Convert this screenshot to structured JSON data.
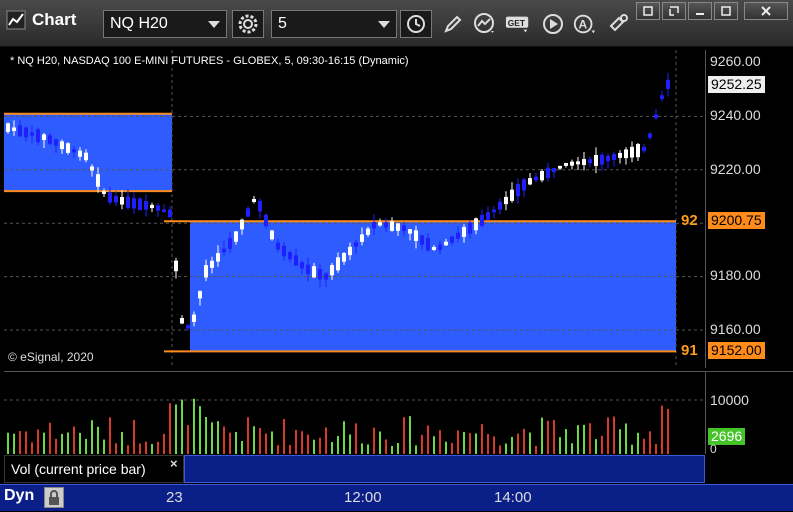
{
  "app": {
    "title": "Chart"
  },
  "toolbar": {
    "symbol": "NQ H20",
    "interval": "5"
  },
  "chart": {
    "header": "* NQ H20, NASDAQ 100 E-MINI FUTURES - GLOBEX, 5, 09:30-16:15 (Dynamic)",
    "copyright": "© eSignal, 2020",
    "price_ticks": [
      "9260.00",
      "9240.00",
      "9220.00",
      "9200.00",
      "9180.00",
      "9160.00"
    ],
    "last_price": "9252.25",
    "level_92_price": "9200.75",
    "level_91_price": "9152.00",
    "level_92_label": "92",
    "level_91_label": "91",
    "colors": {
      "background": "#000000",
      "zone_blue": "#2f5cff",
      "level_orange": "#ff8c1a",
      "candle_up": "#ffffff",
      "candle_down": "#2020ff",
      "vol_up": "#6ad84a",
      "vol_down": "#d83a2a"
    }
  },
  "volume": {
    "label": "Vol (current price bar)",
    "ticks": [
      "10000",
      "0"
    ],
    "current": "2696"
  },
  "time_axis": {
    "mode": "Dyn",
    "labels": [
      "23",
      "12:00",
      "14:00"
    ]
  }
}
